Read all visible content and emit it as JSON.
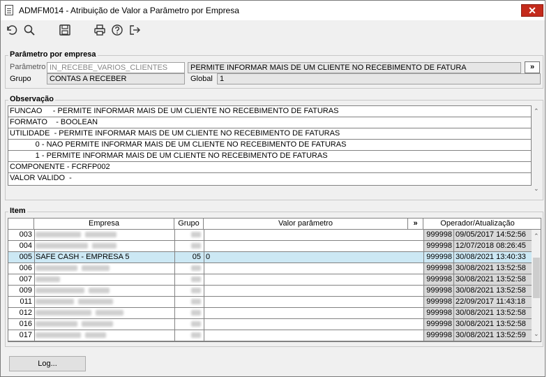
{
  "window": {
    "title": "ADMFM014 - Atribuição de Valor a Parâmetro por Empresa",
    "close_label": "✕"
  },
  "toolbar": {
    "icons": [
      "undo-icon",
      "search-icon",
      "save-icon",
      "print-icon",
      "help-icon",
      "exit-icon"
    ]
  },
  "param_group": {
    "title": "Parâmetro por empresa",
    "parametro_label": "Parâmetro",
    "parametro_value": "IN_RECEBE_VARIOS_CLIENTES",
    "parametro_desc": "PERMITE INFORMAR MAIS DE UM CLIENTE NO RECEBIMENTO DE FATURA",
    "more_label": "»",
    "grupo_label": "Grupo",
    "grupo_value": "CONTAS A RECEBER",
    "global_label": "Global",
    "global_value": "1"
  },
  "observacao": {
    "title": "Observação",
    "lines": [
      "FUNCAO     - PERMITE INFORMAR MAIS DE UM CLIENTE NO RECEBIMENTO DE FATURAS",
      "FORMATO    - BOOLEAN",
      "UTILIDADE  - PERMITE INFORMAR MAIS DE UM CLIENTE NO RECEBIMENTO DE FATURAS",
      "            0 - NAO PERMITE INFORMAR MAIS DE UM CLIENTE NO RECEBIMENTO DE FATURAS",
      "            1 - PERMITE INFORMAR MAIS DE UM CLIENTE NO RECEBIMENTO DE FATURAS",
      "COMPONENTE - FCRFP002",
      "VALOR VALIDO  -"
    ]
  },
  "item": {
    "title": "Item",
    "headers": {
      "empresa": "Empresa",
      "grupo": "Grupo",
      "valor": "Valor parâmetro",
      "more": "»",
      "operador": "Operador/Atualização"
    },
    "rows": [
      {
        "num": "003",
        "empresa": "",
        "grupo": "",
        "valor": "",
        "operador": "999998",
        "data": "09/05/2017 14:52:56"
      },
      {
        "num": "004",
        "empresa": "",
        "grupo": "",
        "valor": "",
        "operador": "999998",
        "data": "12/07/2018 08:26:45"
      },
      {
        "num": "005",
        "empresa": "SAFE CASH -  EMPRESA 5",
        "grupo": "05",
        "valor": "0",
        "operador": "999998",
        "data": "30/08/2021 13:40:33"
      },
      {
        "num": "006",
        "empresa": "",
        "grupo": "",
        "valor": "",
        "operador": "999998",
        "data": "30/08/2021 13:52:58"
      },
      {
        "num": "007",
        "empresa": "",
        "grupo": "",
        "valor": "",
        "operador": "999998",
        "data": "30/08/2021 13:52:58"
      },
      {
        "num": "009",
        "empresa": "",
        "grupo": "",
        "valor": "",
        "operador": "999998",
        "data": "30/08/2021 13:52:58"
      },
      {
        "num": "011",
        "empresa": "",
        "grupo": "",
        "valor": "",
        "operador": "999998",
        "data": "22/09/2017 11:43:18"
      },
      {
        "num": "012",
        "empresa": "",
        "grupo": "",
        "valor": "",
        "operador": "999998",
        "data": "30/08/2021 13:52:58"
      },
      {
        "num": "016",
        "empresa": "",
        "grupo": "",
        "valor": "",
        "operador": "999998",
        "data": "30/08/2021 13:52:58"
      },
      {
        "num": "017",
        "empresa": "",
        "grupo": "",
        "valor": "",
        "operador": "999998",
        "data": "30/08/2021 13:52:59"
      }
    ],
    "selected_row": 2
  },
  "footer": {
    "log_label": "Log..."
  },
  "colors": {
    "selection": "#cce8f4",
    "close_bg": "#c42b1c",
    "window_bg": "#f0f0f0"
  }
}
